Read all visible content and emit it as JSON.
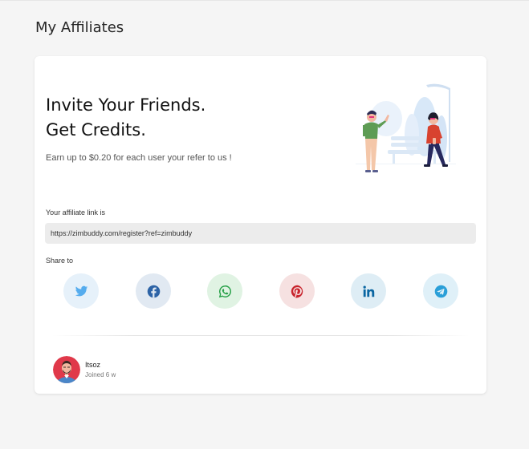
{
  "page": {
    "title": "My Affiliates"
  },
  "invite": {
    "headline_line1": "Invite Your Friends.",
    "headline_line2": "Get Credits.",
    "subtext": "Earn up to $0.20 for each user your refer to us !"
  },
  "affiliate": {
    "link_label": "Your affiliate link is",
    "link_value": "https://zimbuddy.com/register?ref=zimbuddy"
  },
  "share": {
    "label": "Share to",
    "buttons": [
      {
        "network": "twitter",
        "icon": "twitter-icon",
        "bg": "#e6f1fa",
        "color": "#55acee"
      },
      {
        "network": "facebook",
        "icon": "facebook-icon",
        "bg": "#e1e9f2",
        "color": "#2d63a6"
      },
      {
        "network": "whatsapp",
        "icon": "whatsapp-icon",
        "bg": "#e0f3e3",
        "color": "#25a046"
      },
      {
        "network": "pinterest",
        "icon": "pinterest-icon",
        "bg": "#f6e1e1",
        "color": "#c8232c"
      },
      {
        "network": "linkedin",
        "icon": "linkedin-icon",
        "bg": "#deedf5",
        "color": "#0a66a2"
      },
      {
        "network": "telegram",
        "icon": "telegram-icon",
        "bg": "#dff0f8",
        "color": "#2a9fd8"
      }
    ]
  },
  "user": {
    "name": "Itsoz",
    "joined": "Joined 6 w"
  },
  "colors": {
    "page_bg": "#f5f5f5",
    "card_bg": "#ffffff",
    "link_box_bg": "#ececec",
    "avatar_bg": "#e0394a"
  }
}
